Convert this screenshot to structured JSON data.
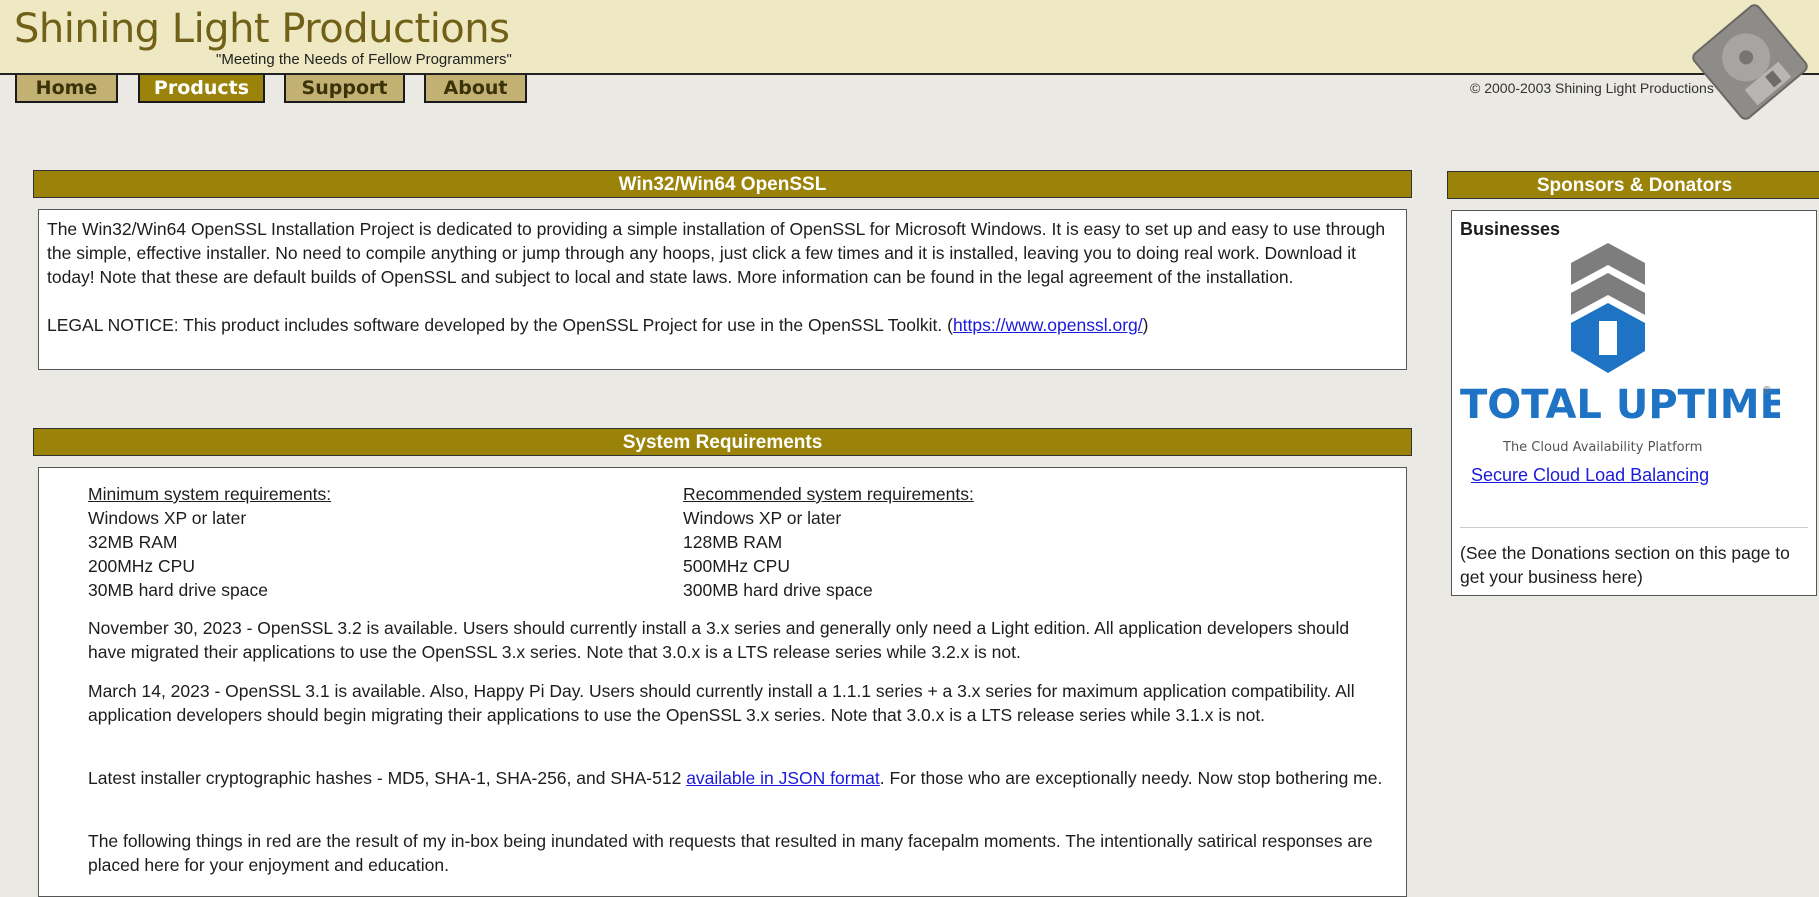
{
  "header": {
    "title": "Shining Light Productions",
    "tagline": "\"Meeting the Needs of Fellow Programmers\"",
    "logo_icon": "floppy-disk-icon"
  },
  "nav": {
    "tabs": [
      {
        "label": "Home",
        "active": false
      },
      {
        "label": "Products",
        "active": true
      },
      {
        "label": "Support",
        "active": false
      },
      {
        "label": "About",
        "active": false
      }
    ]
  },
  "copyright": "© 2000-2003 Shining Light Productions",
  "intro": {
    "heading": "Win32/Win64 OpenSSL",
    "paragraph": "The Win32/Win64 OpenSSL Installation Project is dedicated to providing a simple installation of OpenSSL for Microsoft Windows. It is easy to set up and easy to use through the simple, effective installer. No need to compile anything or jump through any hoops, just click a few times and it is installed, leaving you to doing real work. Download it today! Note that these are default builds of OpenSSL and subject to local and state laws. More information can be found in the legal agreement of the installation.",
    "legal_prefix": "LEGAL NOTICE: This product includes software developed by the OpenSSL Project for use in the OpenSSL Toolkit. (",
    "legal_link": "https://www.openssl.org/",
    "legal_suffix": ")"
  },
  "sysreq": {
    "heading": "System Requirements",
    "minimum": {
      "title": "Minimum system requirements:",
      "items": [
        "Windows XP or later",
        "32MB RAM",
        "200MHz CPU",
        "30MB hard drive space"
      ]
    },
    "recommended": {
      "title": "Recommended system requirements:",
      "items": [
        "Windows XP or later",
        "128MB RAM",
        "500MHz CPU",
        "300MB hard drive space"
      ]
    },
    "news": [
      "November 30, 2023 - OpenSSL 3.2 is available. Users should currently install a 3.x series and generally only need a Light edition. All application developers should have migrated their applications to use the OpenSSL 3.x series. Note that 3.0.x is a LTS release series while 3.2.x is not.",
      "March 14, 2023 - OpenSSL 3.1 is available. Also, Happy Pi Day. Users should currently install a 1.1.1 series + a 3.x series for maximum application compatibility. All application developers should begin migrating their applications to use the OpenSSL 3.x series. Note that 3.0.x is a LTS release series while 3.1.x is not."
    ],
    "hashes_prefix": "Latest installer cryptographic hashes - MD5, SHA-1, SHA-256, and SHA-512 ",
    "hashes_link": "available in JSON format",
    "hashes_suffix": ". For those who are exceptionally needy. Now stop bothering me.",
    "red_note": "The following things in red are the result of my in-box being inundated with requests that resulted in many facepalm moments. The intentionally satirical responses are placed here for your enjoyment and education."
  },
  "sponsors": {
    "heading": "Sponsors & Donators",
    "category": "Businesses",
    "logo_text": "TOTAL UPTIME",
    "logo_registered": "®",
    "logo_subtitle": "The Cloud Availability Platform",
    "link": "Secure Cloud Load Balancing",
    "note": "(See the Donations section on this page to get your business here)"
  }
}
